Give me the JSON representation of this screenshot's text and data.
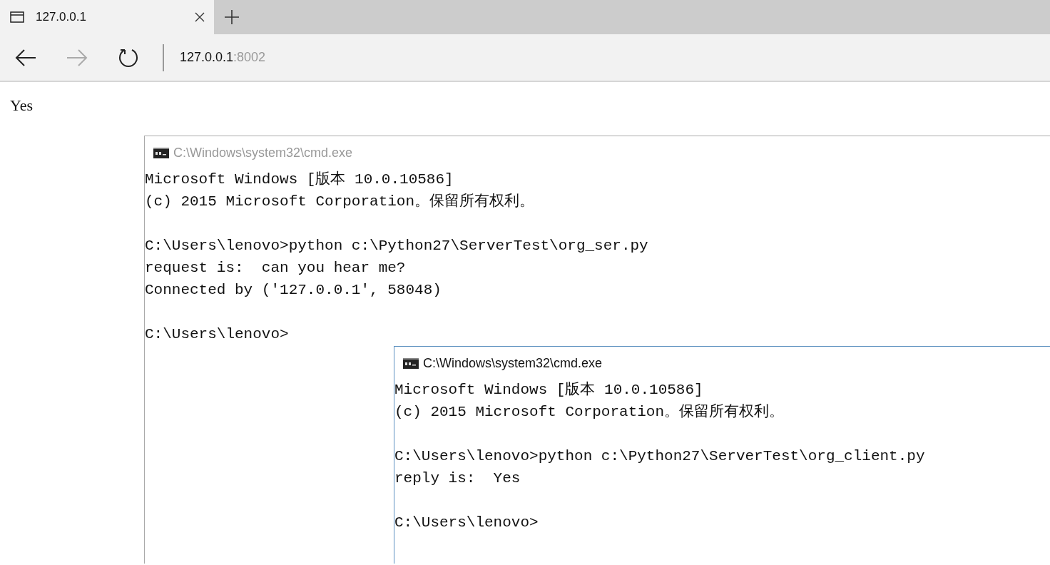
{
  "tab": {
    "title": "127.0.0.1"
  },
  "address": {
    "host": "127.0.0.1",
    "port": ":8002"
  },
  "nav": {
    "back_disabled": false,
    "forward_disabled": true
  },
  "page_text": "Yes",
  "windows": [
    {
      "title": "C:\\Windows\\system32\\cmd.exe",
      "active": false,
      "blocks": [
        [
          "Microsoft Windows [版本 10.0.10586]",
          "(c) 2015 Microsoft Corporation。保留所有权利。"
        ],
        [
          "C:\\Users\\lenovo>python c:\\Python27\\ServerTest\\org_ser.py",
          "request is:  can you hear me?",
          "Connected by ('127.0.0.1', 58048)"
        ],
        [
          "C:\\Users\\lenovo>"
        ]
      ]
    },
    {
      "title": "C:\\Windows\\system32\\cmd.exe",
      "active": true,
      "blocks": [
        [
          "Microsoft Windows [版本 10.0.10586]",
          "(c) 2015 Microsoft Corporation。保留所有权利。"
        ],
        [
          "C:\\Users\\lenovo>python c:\\Python27\\ServerTest\\org_client.py",
          "reply is:  Yes"
        ],
        [
          "C:\\Users\\lenovo>"
        ]
      ]
    }
  ]
}
